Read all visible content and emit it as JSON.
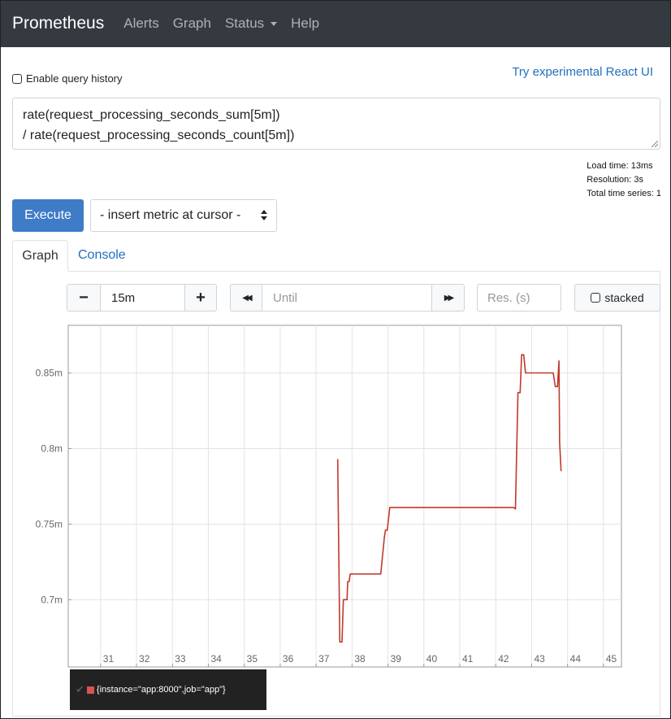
{
  "navbar": {
    "brand": "Prometheus",
    "items": [
      "Alerts",
      "Graph",
      "Status",
      "Help"
    ]
  },
  "query_history_label": "Enable query history",
  "react_ui_link": "Try experimental React UI",
  "expression": {
    "line1": "rate(request_processing_seconds_sum[5m])",
    "line2": "/ rate(request_processing_seconds_count[5m])"
  },
  "stats": {
    "load_time": "Load time: 13ms",
    "resolution": "Resolution: 3s",
    "total_series": "Total time series: 1"
  },
  "execute_label": "Execute",
  "metric_select_label": "- insert metric at cursor -",
  "tabs": [
    "Graph",
    "Console"
  ],
  "controls": {
    "minus": "−",
    "range": "15m",
    "plus": "+",
    "back": "◀◀",
    "until_placeholder": "Until",
    "forward": "▶▶",
    "res_placeholder": "Res. (s)",
    "stacked_label": "stacked"
  },
  "colors": {
    "series": "#c0392b",
    "primary": "#3f7cc8",
    "navbar": "#343a40"
  },
  "chart_data": {
    "type": "line",
    "x_ticks": [
      "31",
      "32",
      "33",
      "34",
      "35",
      "36",
      "37",
      "38",
      "39",
      "40",
      "41",
      "42",
      "43",
      "44",
      "45"
    ],
    "y_ticks": [
      "0.7m",
      "0.75m",
      "0.8m",
      "0.85m"
    ],
    "xlim": [
      30.1,
      45.5
    ],
    "ylim": [
      0.6555,
      0.8815
    ],
    "grid": true,
    "series": [
      {
        "name": "{instance=\"app:8000\",job=\"app\"}",
        "points": [
          [
            37.6,
            0.793
          ],
          [
            37.66,
            0.672
          ],
          [
            37.72,
            0.672
          ],
          [
            37.76,
            0.7
          ],
          [
            37.86,
            0.7
          ],
          [
            37.88,
            0.712
          ],
          [
            37.92,
            0.712
          ],
          [
            37.95,
            0.717
          ],
          [
            38.8,
            0.717
          ],
          [
            38.9,
            0.741
          ],
          [
            38.93,
            0.746
          ],
          [
            38.98,
            0.746
          ],
          [
            39.05,
            0.761
          ],
          [
            42.5,
            0.761
          ],
          [
            42.55,
            0.76
          ],
          [
            42.62,
            0.837
          ],
          [
            42.68,
            0.837
          ],
          [
            42.72,
            0.862
          ],
          [
            42.78,
            0.862
          ],
          [
            42.83,
            0.85
          ],
          [
            43.6,
            0.85
          ],
          [
            43.66,
            0.841
          ],
          [
            43.72,
            0.841
          ],
          [
            43.76,
            0.858
          ],
          [
            43.78,
            0.804
          ],
          [
            43.82,
            0.785
          ]
        ]
      }
    ]
  }
}
